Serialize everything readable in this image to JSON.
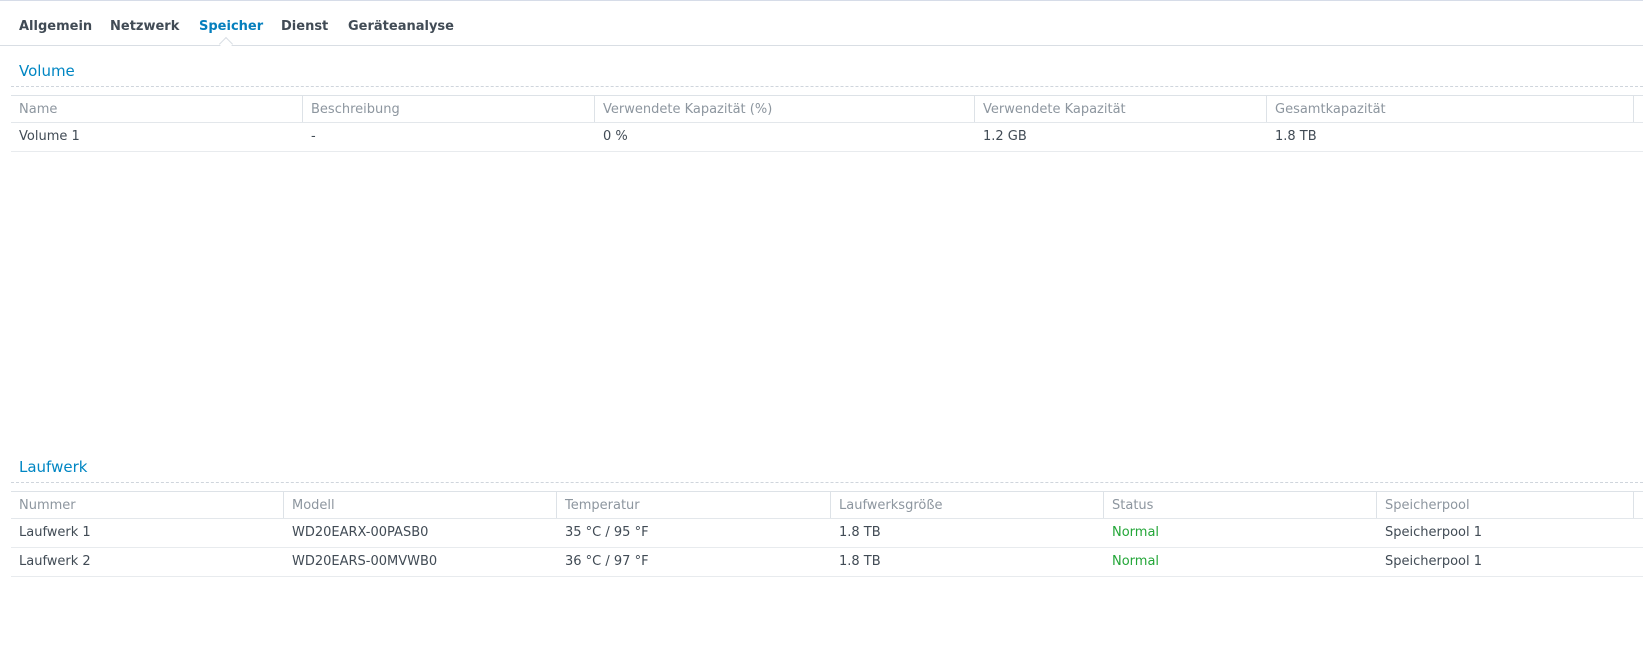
{
  "tabs": [
    {
      "label": "Allgemein",
      "active": false
    },
    {
      "label": "Netzwerk",
      "active": false
    },
    {
      "label": "Speicher",
      "active": true
    },
    {
      "label": "Dienst",
      "active": false
    },
    {
      "label": "Geräteanalyse",
      "active": false
    }
  ],
  "volume": {
    "title": "Volume",
    "columns": [
      "Name",
      "Beschreibung",
      "Verwendete Kapazität (%)",
      "Verwendete Kapazität",
      "Gesamtkapazität"
    ],
    "rows": [
      [
        "Volume 1",
        "-",
        "0 %",
        "1.2 GB",
        "1.8 TB"
      ]
    ]
  },
  "drives": {
    "title": "Laufwerk",
    "columns": [
      "Nummer",
      "Modell",
      "Temperatur",
      "Laufwerksgröße",
      "Status",
      "Speicherpool"
    ],
    "rows": [
      [
        "Laufwerk 1",
        "WD20EARX-00PASB0",
        "35 °C / 95 °F",
        "1.8 TB",
        "Normal",
        "Speicherpool 1"
      ],
      [
        "Laufwerk 2",
        "WD20EARS-00MVWB0",
        "36 °C / 97 °F",
        "1.8 TB",
        "Normal",
        "Speicherpool 1"
      ]
    ]
  },
  "colors": {
    "accent": "#0086c3",
    "active_tab": "#057fbd",
    "status_normal": "#23a638"
  }
}
